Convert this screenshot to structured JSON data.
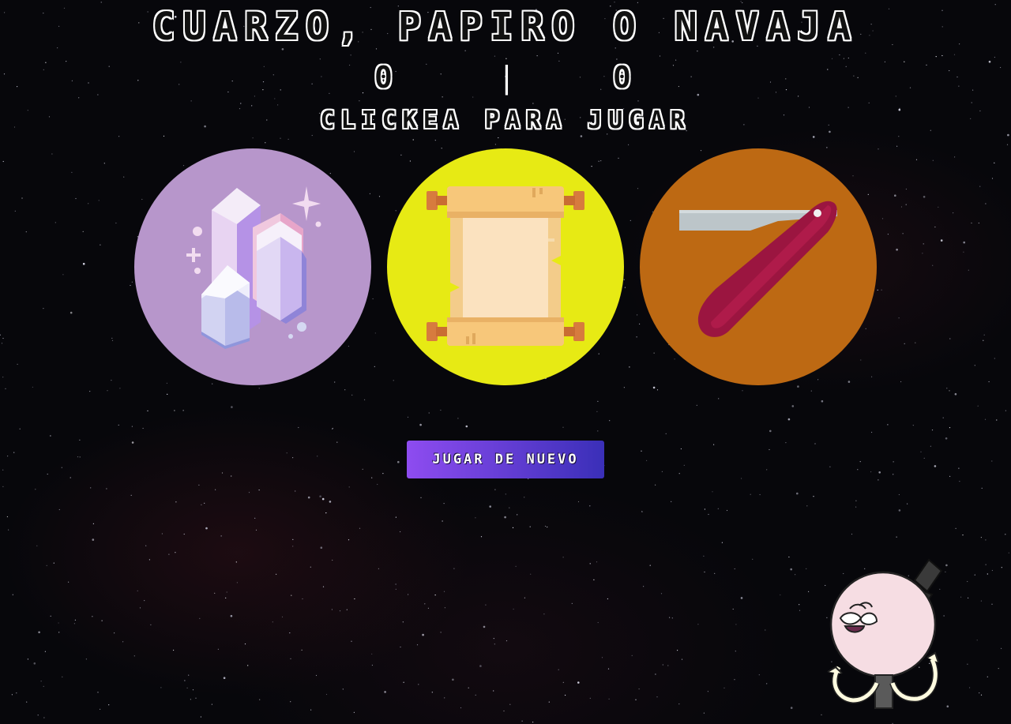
{
  "game": {
    "title": "CUARZO, PAPIRO O NAVAJA",
    "subtitle": "CLICKEA PARA JUGAR",
    "score": {
      "player": "0",
      "separator": "|",
      "computer": "0"
    }
  },
  "choices": [
    {
      "id": "quartz",
      "icon": "quartz-crystal-icon",
      "color": "#b796cb"
    },
    {
      "id": "paper",
      "icon": "papyrus-scroll-icon",
      "color": "#e7ea14"
    },
    {
      "id": "razor",
      "icon": "straight-razor-icon",
      "color": "#bd6913"
    }
  ],
  "actions": {
    "play_again_label": "JUGAR DE NUEVO"
  },
  "decor": {
    "character_icon": "pops-character-icon"
  }
}
